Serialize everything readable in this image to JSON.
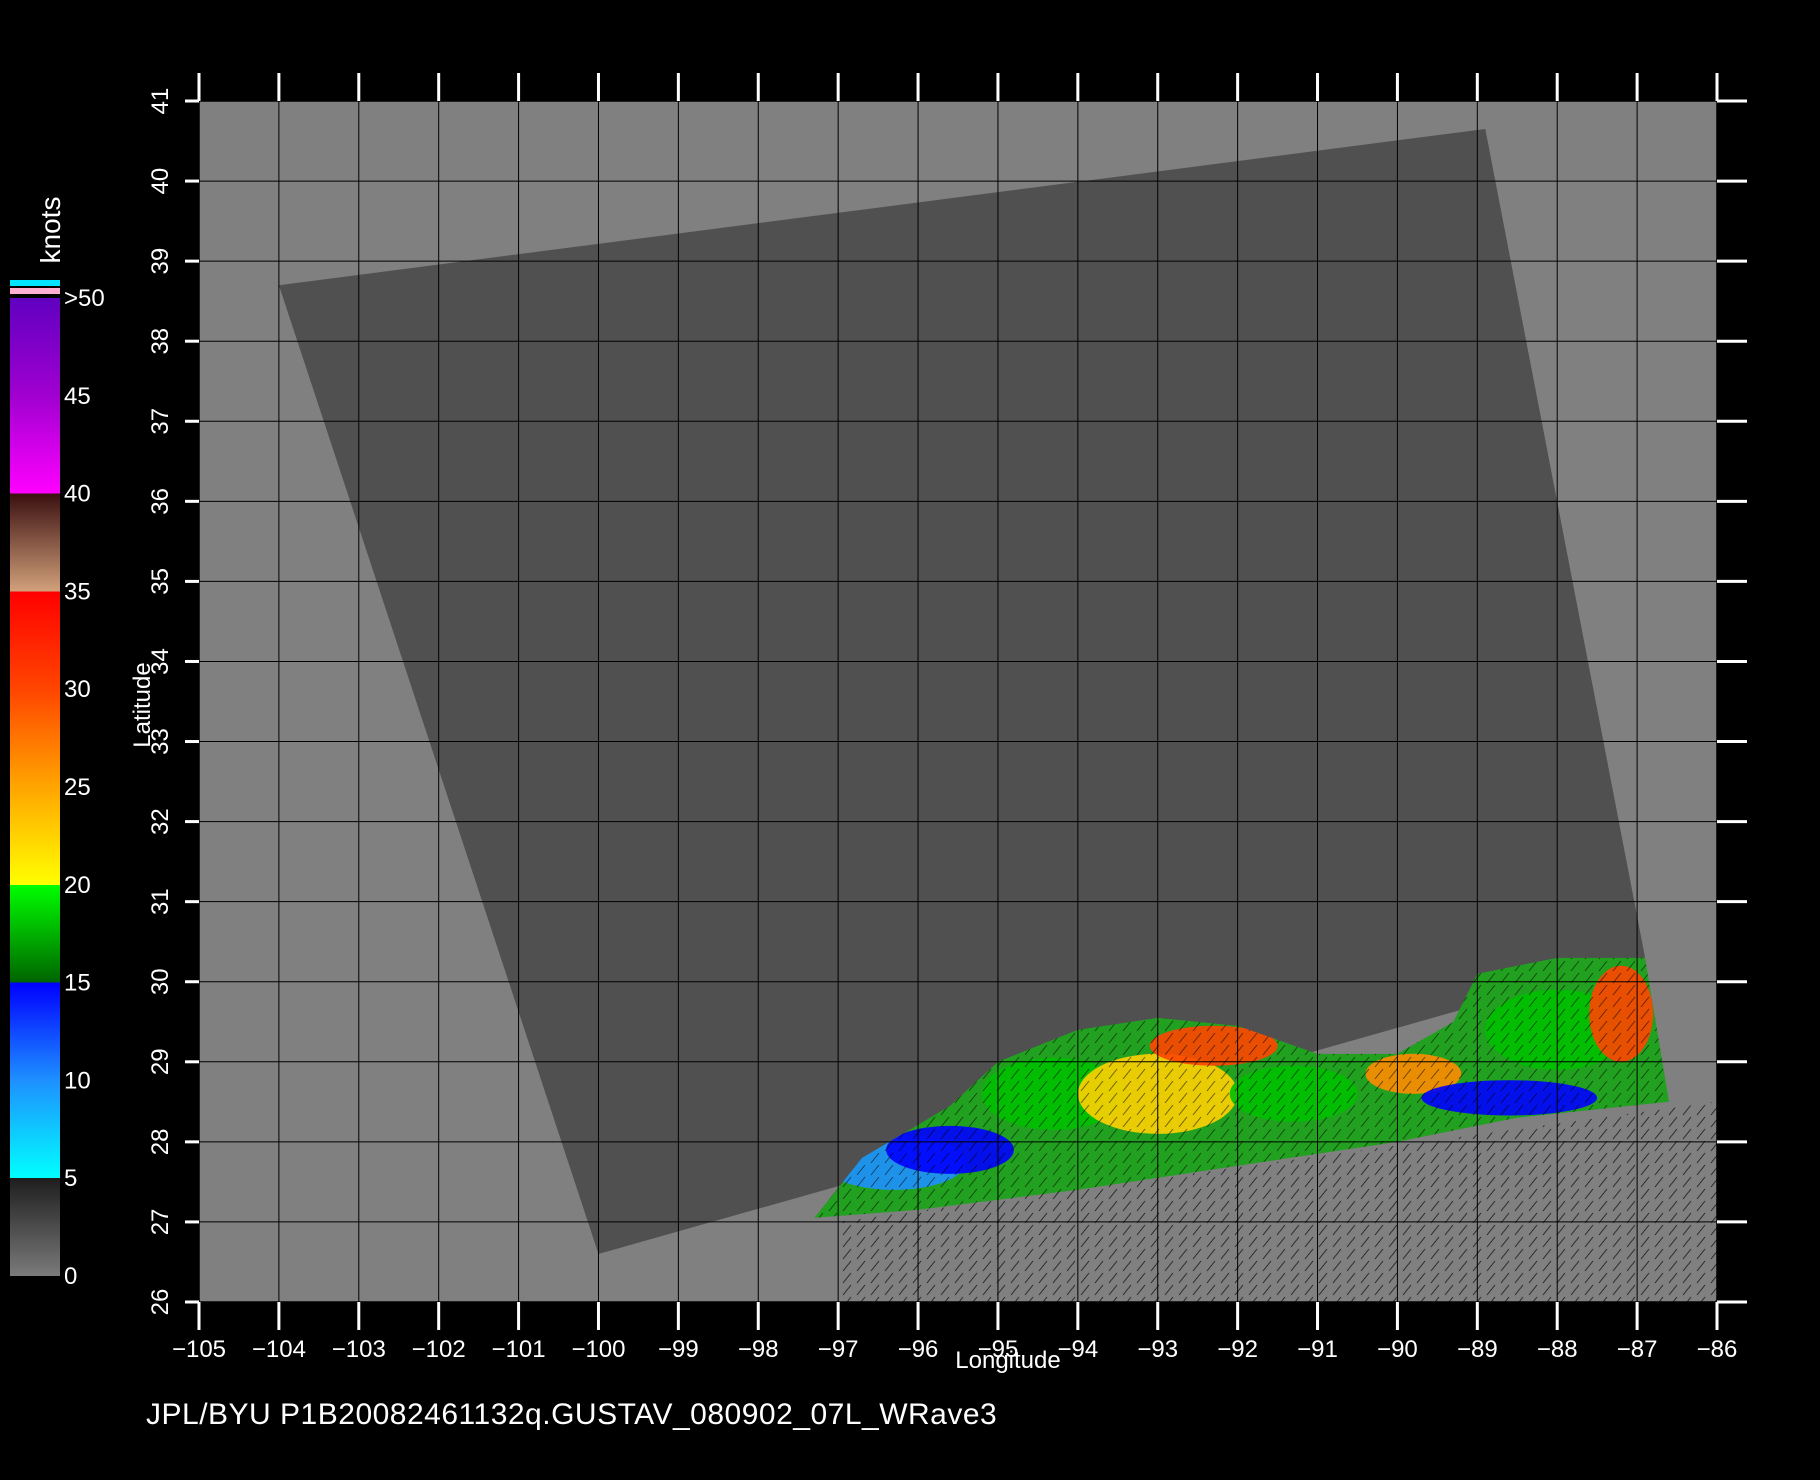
{
  "colors": {
    "background": "#000000",
    "plot_background": "#808080",
    "swath": "#505050",
    "grid": "#000000",
    "text": "#ffffff"
  },
  "axes": {
    "xlabel": "Longitude",
    "ylabel": "Latitude",
    "xticks": [
      "-105",
      "-104",
      "-103",
      "-102",
      "-101",
      "-100",
      "-99",
      "-98",
      "-97",
      "-96",
      "-95",
      "-94",
      "-93",
      "-92",
      "-91",
      "-90",
      "-89",
      "-88",
      "-87",
      "-86"
    ],
    "yticks": [
      "26",
      "27",
      "28",
      "29",
      "30",
      "31",
      "32",
      "33",
      "34",
      "35",
      "36",
      "37",
      "38",
      "39",
      "40",
      "41"
    ],
    "xlim": [
      -105,
      -86
    ],
    "ylim": [
      26,
      41
    ]
  },
  "colorbar": {
    "title": "knots",
    "labels": [
      "0",
      "5",
      "10",
      "15",
      "20",
      "25",
      "30",
      "35",
      "40",
      "45",
      ">50"
    ],
    "min": 0,
    "max": 50,
    "stops": [
      {
        "v": 0,
        "color": "#7a7a7a"
      },
      {
        "v": 5,
        "color": "#1e1e1e"
      },
      {
        "v": 5,
        "color": "#00ffff"
      },
      {
        "v": 10,
        "color": "#1e90ff"
      },
      {
        "v": 15,
        "color": "#0000ff"
      },
      {
        "v": 15,
        "color": "#006400"
      },
      {
        "v": 20,
        "color": "#00ff00"
      },
      {
        "v": 20,
        "color": "#ffff00"
      },
      {
        "v": 25,
        "color": "#ffa500"
      },
      {
        "v": 30,
        "color": "#ff4500"
      },
      {
        "v": 35,
        "color": "#ff0000"
      },
      {
        "v": 35,
        "color": "#d2a07a"
      },
      {
        "v": 40,
        "color": "#3a1010"
      },
      {
        "v": 40,
        "color": "#ff00ff"
      },
      {
        "v": 45,
        "color": "#a000d0"
      },
      {
        "v": 50,
        "color": "#6000c0"
      }
    ]
  },
  "swath_corners": [
    {
      "lon": -104.0,
      "lat": 38.7
    },
    {
      "lon": -88.9,
      "lat": 40.65
    },
    {
      "lon": -86.9,
      "lat": 30.3
    },
    {
      "lon": -100.0,
      "lat": 26.6
    }
  ],
  "wind_region": [
    {
      "lon": -97.3,
      "lat": 27.05
    },
    {
      "lon": -96.7,
      "lat": 27.8
    },
    {
      "lon": -95.6,
      "lat": 28.45
    },
    {
      "lon": -95.0,
      "lat": 29.0
    },
    {
      "lon": -94.0,
      "lat": 29.4
    },
    {
      "lon": -93.0,
      "lat": 29.55
    },
    {
      "lon": -92.0,
      "lat": 29.45
    },
    {
      "lon": -91.0,
      "lat": 29.1
    },
    {
      "lon": -90.0,
      "lat": 29.1
    },
    {
      "lon": -89.3,
      "lat": 29.5
    },
    {
      "lon": -89.0,
      "lat": 30.1
    },
    {
      "lon": -88.0,
      "lat": 30.3
    },
    {
      "lon": -86.9,
      "lat": 30.3
    },
    {
      "lon": -86.6,
      "lat": 28.5
    },
    {
      "lon": -88.5,
      "lat": 28.3
    },
    {
      "lon": -90.0,
      "lat": 28.0
    },
    {
      "lon": -92.0,
      "lat": 27.7
    },
    {
      "lon": -94.0,
      "lat": 27.4
    },
    {
      "lon": -96.0,
      "lat": 27.15
    },
    {
      "lon": -97.3,
      "lat": 27.05
    }
  ],
  "wind_blobs": [
    {
      "lon": -96.3,
      "lat": 27.75,
      "rlon": 0.9,
      "rlat": 0.35,
      "color": "#1e90ff"
    },
    {
      "lon": -95.6,
      "lat": 27.9,
      "rlon": 0.8,
      "rlat": 0.3,
      "color": "#0000ff"
    },
    {
      "lon": -94.3,
      "lat": 28.6,
      "rlon": 0.9,
      "rlat": 0.45,
      "color": "#00c000"
    },
    {
      "lon": -93.0,
      "lat": 28.6,
      "rlon": 1.0,
      "rlat": 0.5,
      "color": "#ffd000"
    },
    {
      "lon": -92.3,
      "lat": 29.2,
      "rlon": 0.8,
      "rlat": 0.25,
      "color": "#ff4500"
    },
    {
      "lon": -91.3,
      "lat": 28.6,
      "rlon": 0.8,
      "rlat": 0.35,
      "color": "#00c000"
    },
    {
      "lon": -89.8,
      "lat": 28.85,
      "rlon": 0.6,
      "rlat": 0.25,
      "color": "#ff8c00"
    },
    {
      "lon": -88.6,
      "lat": 28.55,
      "rlon": 1.1,
      "rlat": 0.22,
      "color": "#0000ff"
    },
    {
      "lon": -88.0,
      "lat": 29.4,
      "rlon": 0.9,
      "rlat": 0.5,
      "color": "#00c000"
    },
    {
      "lon": -87.2,
      "lat": 29.6,
      "rlon": 0.4,
      "rlat": 0.6,
      "color": "#ff4500"
    }
  ],
  "caption": "JPL/BYU  P1B20082461132q.GUSTAV_080902_07L_WRave3"
}
